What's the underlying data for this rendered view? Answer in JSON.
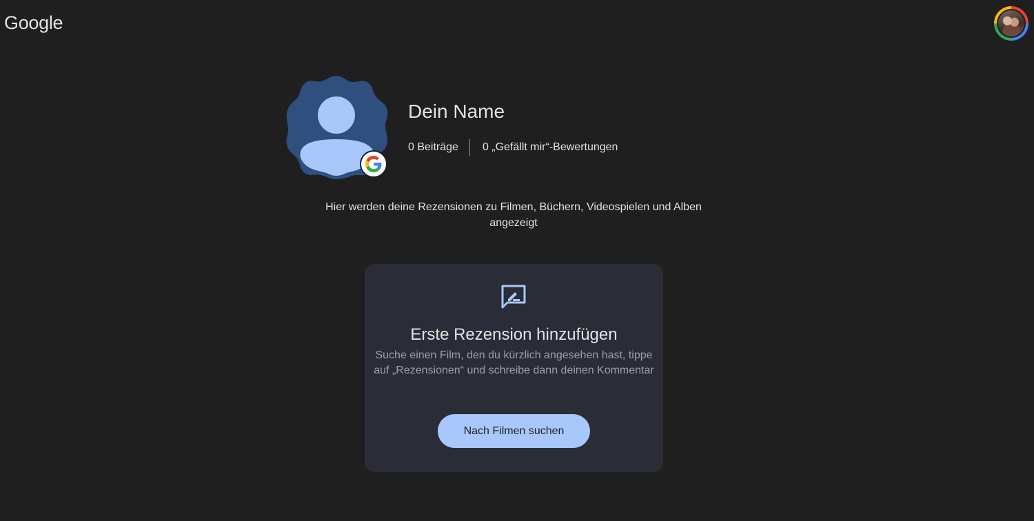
{
  "header": {
    "logo_text": "Google",
    "account_avatar_icon": "account-photo"
  },
  "profile": {
    "name": "Dein Name",
    "posts": "0 Beiträge",
    "likes": "0 „Gefällt mir“-Bewertungen",
    "avatar_icon": "default-person-avatar",
    "badge_icon": "google-g-icon"
  },
  "intro": {
    "text": "Hier werden deine Rezensionen zu Filmen, Büchern, Videospielen und Alben angezeigt"
  },
  "card": {
    "icon": "rate-review-icon",
    "title": "Erste Rezension hinzufügen",
    "description": "Suche einen Film, den du kürzlich angesehen hast, tippe auf „Rezensionen“ und schreibe dann deinen Kommentar",
    "button_label": "Nach Filmen suchen"
  },
  "colors": {
    "background": "#1f1f1f",
    "card_background": "#2a2d37",
    "accent": "#a8c7fa",
    "avatar_blob": "#2f4f7f",
    "avatar_person": "#a8c7fa"
  }
}
